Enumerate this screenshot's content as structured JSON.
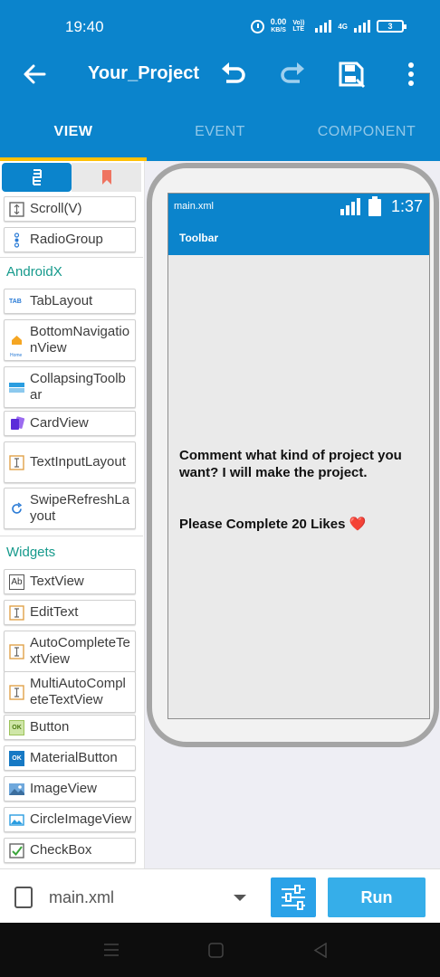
{
  "status_bar": {
    "time": "19:40",
    "net_speed_value": "0.00",
    "net_speed_unit": "KB/S",
    "volte_label": "Vo)) LTE",
    "network_label": "4G",
    "battery_level": "3"
  },
  "toolbar": {
    "title": "Your_Project"
  },
  "tabs": [
    {
      "label": "VIEW",
      "active": true
    },
    {
      "label": "EVENT",
      "active": false
    },
    {
      "label": "COMPONENT",
      "active": false
    }
  ],
  "palette": {
    "top_items": [
      {
        "label": "Scroll(V)",
        "icon": "scroll-vertical-icon"
      },
      {
        "label": "RadioGroup",
        "icon": "radio-group-icon"
      }
    ],
    "androidx": {
      "title": "AndroidX",
      "items": [
        {
          "label": "TabLayout",
          "icon": "tab-layout-icon",
          "icon_text": "TAB"
        },
        {
          "label": "BottomNavigationView",
          "icon": "home-icon",
          "icon_text": "Home"
        },
        {
          "label": "CollapsingToolbar",
          "icon": "collapsing-toolbar-icon"
        },
        {
          "label": "CardView",
          "icon": "card-view-icon"
        },
        {
          "label": "TextInputLayout",
          "icon": "text-input-icon"
        },
        {
          "label": "SwipeRefreshLayout",
          "icon": "refresh-icon"
        }
      ]
    },
    "widgets": {
      "title": "Widgets",
      "items": [
        {
          "label": "TextView",
          "icon": "text-view-icon",
          "icon_text": "Ab"
        },
        {
          "label": "EditText",
          "icon": "edit-text-icon"
        },
        {
          "label": "AutoCompleteTextView",
          "icon": "auto-complete-icon"
        },
        {
          "label": "MultiAutoCompleteTextView",
          "icon": "multi-auto-complete-icon"
        },
        {
          "label": "Button",
          "icon": "button-icon",
          "icon_text": "OK"
        },
        {
          "label": "MaterialButton",
          "icon": "material-button-icon",
          "icon_text": "OK"
        },
        {
          "label": "ImageView",
          "icon": "image-view-icon"
        },
        {
          "label": "CircleImageView",
          "icon": "circle-image-view-icon"
        },
        {
          "label": "CheckBox",
          "icon": "checkbox-icon"
        }
      ]
    }
  },
  "preview": {
    "file_name": "main.xml",
    "clock": "1:37",
    "toolbar_title": "Toolbar",
    "text1": "Comment what kind of project you want? I will make the project.",
    "text2": "Please Complete 20 Likes ❤️"
  },
  "bottom_bar": {
    "file": "main.xml",
    "run_label": "Run"
  },
  "colors": {
    "primary": "#0b84cc",
    "tab_indicator": "#ffc107",
    "section_title": "#169a8c",
    "run_button": "#36aee9"
  }
}
